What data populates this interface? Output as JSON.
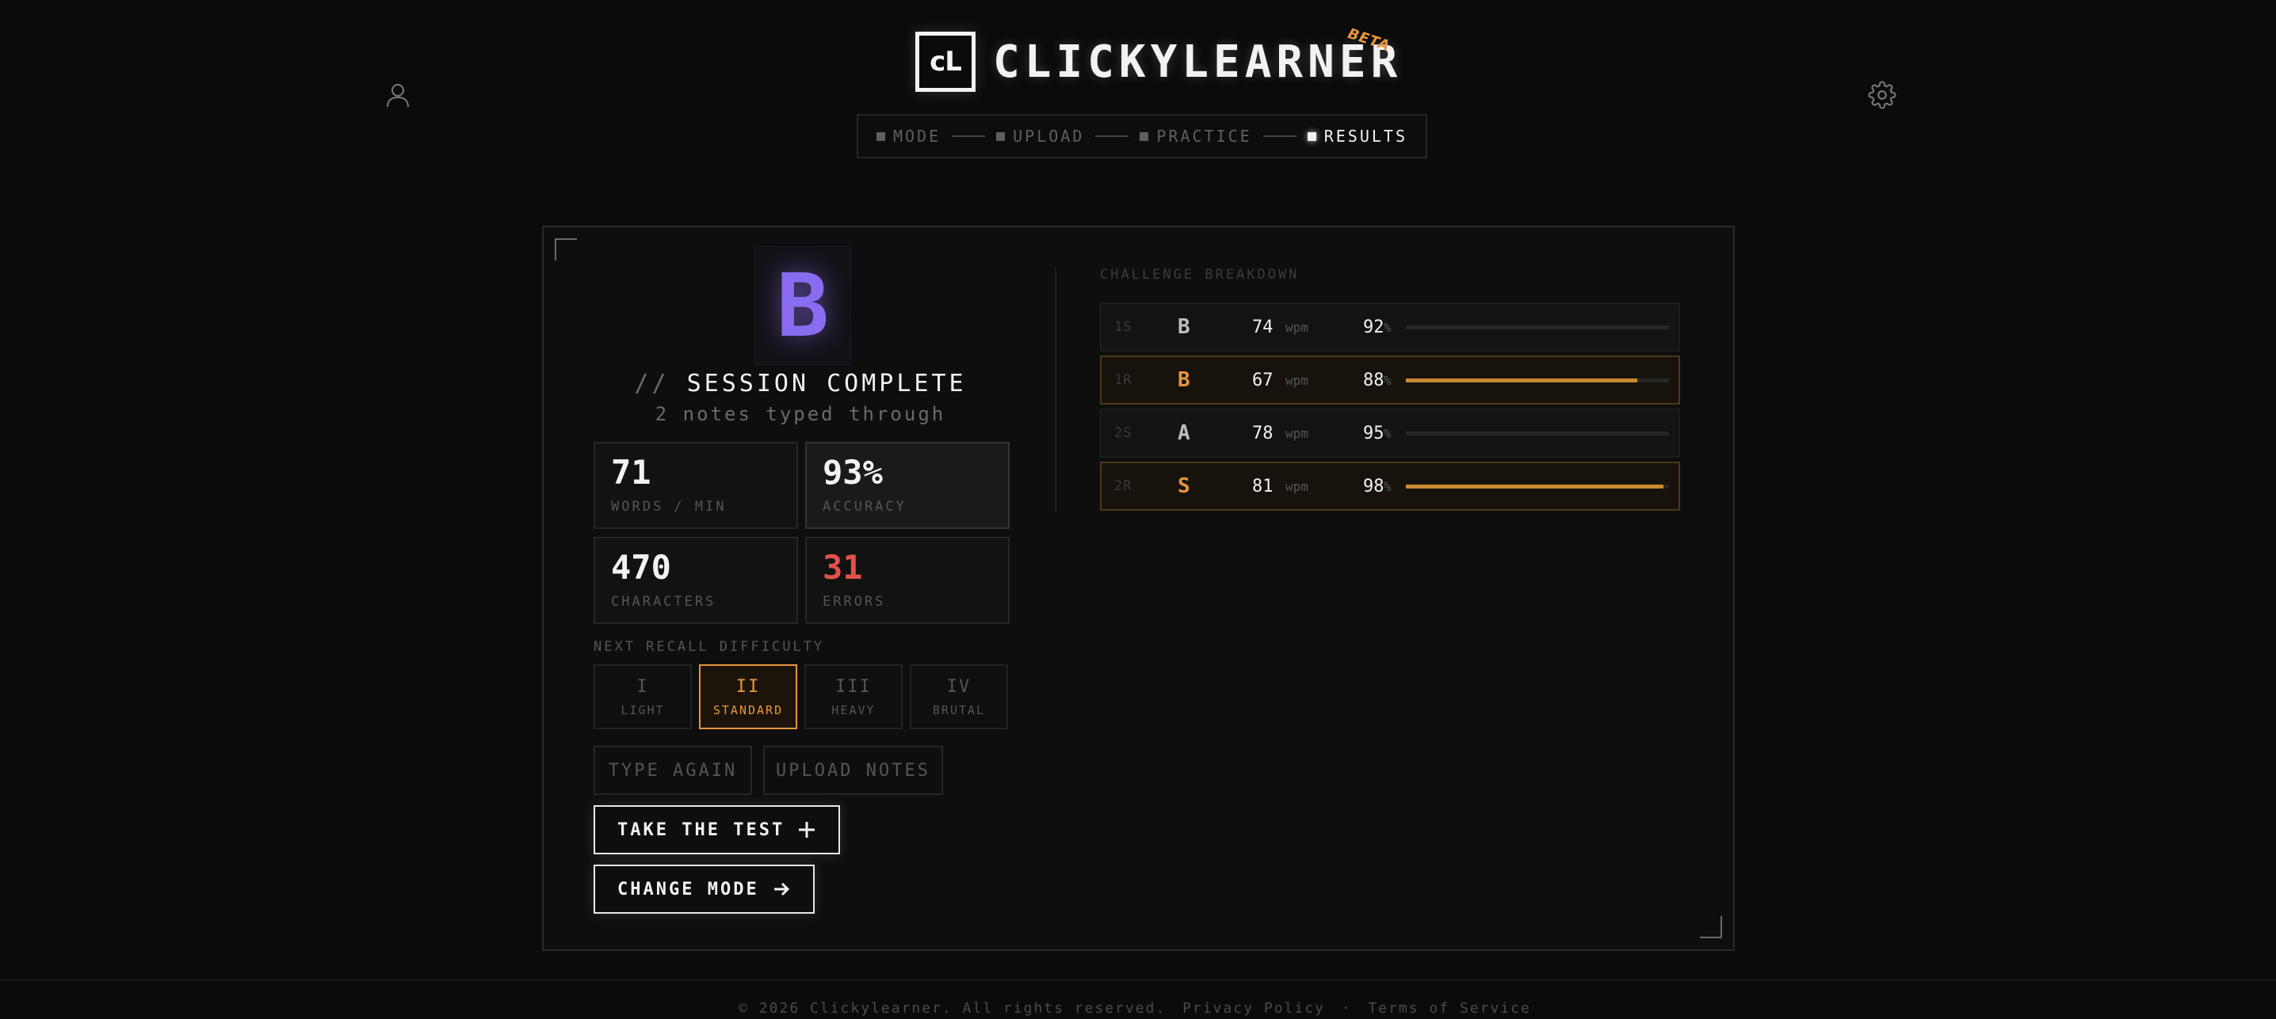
{
  "brand": {
    "logo": "cL",
    "name": "CLICKYLEARNER",
    "badge": "BETA"
  },
  "header": {
    "user_icon": "user-icon",
    "settings_icon": "gear-icon"
  },
  "stepper": {
    "steps": [
      {
        "label": "MODE",
        "state": "done"
      },
      {
        "label": "UPLOAD",
        "state": "done"
      },
      {
        "label": "PRACTICE",
        "state": "done"
      },
      {
        "label": "RESULTS",
        "state": "active"
      }
    ]
  },
  "session": {
    "grade": "B",
    "grade_color": "#8a6cf0",
    "title_prefix": "//",
    "title": "SESSION COMPLETE",
    "subtitle": "2 notes typed through"
  },
  "stats": [
    {
      "value": "71",
      "label": "WORDS / MIN"
    },
    {
      "value": "93%",
      "label": "ACCURACY"
    },
    {
      "value": "470",
      "label": "CHARACTERS"
    },
    {
      "value": "31",
      "label": "ERRORS",
      "color": "#e0524a"
    }
  ],
  "difficulty": {
    "heading": "NEXT RECALL DIFFICULTY",
    "options": [
      {
        "num": "I",
        "name": "LIGHT"
      },
      {
        "num": "II",
        "name": "STANDARD",
        "selected": true
      },
      {
        "num": "III",
        "name": "HEAVY"
      },
      {
        "num": "IV",
        "name": "BRUTAL"
      }
    ]
  },
  "actions": {
    "type_again": "TYPE AGAIN",
    "upload_notes": "UPLOAD NOTES",
    "take_test": "TAKE THE TEST",
    "change_mode": "CHANGE MODE"
  },
  "breakdown": {
    "heading": "CHALLENGE BREAKDOWN",
    "wpm_unit": "wpm",
    "acc_unit": "%",
    "rows": [
      {
        "id": "1S",
        "grade": "B",
        "wpm": "74",
        "acc": "92",
        "progress": 0.0,
        "highlight": false
      },
      {
        "id": "1R",
        "grade": "B",
        "wpm": "67",
        "acc": "88",
        "progress": 0.88,
        "highlight": true
      },
      {
        "id": "2S",
        "grade": "A",
        "wpm": "78",
        "acc": "95",
        "progress": 0.0,
        "highlight": false
      },
      {
        "id": "2R",
        "grade": "S",
        "wpm": "81",
        "acc": "98",
        "progress": 0.98,
        "highlight": true
      }
    ]
  },
  "footer": {
    "copyright": "© 2026 Clickylearner. All rights reserved.",
    "privacy": "Privacy Policy",
    "separator": "·",
    "terms": "Terms of Service"
  },
  "colors": {
    "accent": "#e6963c",
    "background": "#0b0b0b"
  }
}
